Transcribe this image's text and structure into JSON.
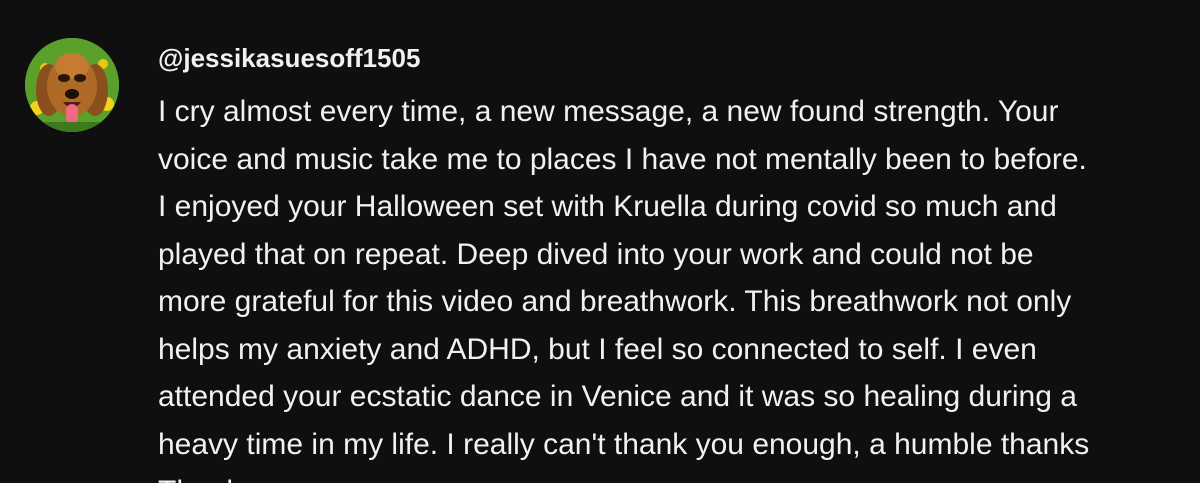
{
  "comment": {
    "author": "@jessikasuesoff1505",
    "lines": [
      "I cry almost every time, a new message, a new found strength. Your",
      "voice and music take me to places I have not mentally been to before.",
      "I enjoyed your Halloween set with Kruella during covid so much and",
      "played that on repeat. Deep dived into your work and could not be",
      "more grateful for this video and breathwork. This breathwork not only",
      "helps my anxiety and ADHD, but I feel so connected to self. I even",
      "attended your ecstatic dance in Venice and it was so healing during a",
      "heavy time in my life. I really can't thank you enough, a humble thanks",
      "Thank you"
    ]
  },
  "colors": {
    "background": "#0f0f0f",
    "text": "#f1f1f1"
  }
}
